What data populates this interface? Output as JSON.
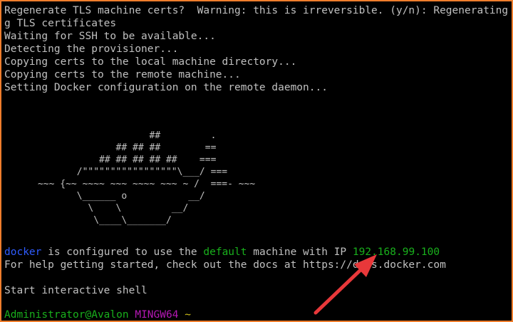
{
  "terminal": {
    "output_lines": [
      "Regenerate TLS machine certs?  Warning: this is irreversible. (y/n): Regenerating",
      "g TLS certificates",
      "Waiting for SSH to be available...",
      "Detecting the provisioner...",
      "Copying certs to the local machine directory...",
      "Copying certs to the remote machine...",
      "Setting Docker configuration on the remote daemon..."
    ],
    "whale_art": "                          ##         .\n                    ## ## ##        ==\n                 ## ## ## ## ##    ===\n             /\"\"\"\"\"\"\"\"\"\"\"\"\"\"\"\"\"\\___/ ===\n      ~~~ {~~ ~~~~ ~~~ ~~~~ ~~~ ~ /  ===- ~~~\n             \\______ o           __/\n               \\    \\         __/\n                \\____\\_______/",
    "configured": {
      "machine_tool": "docker",
      "text_1": " is configured to use the ",
      "machine_name": "default",
      "text_2": " machine with IP ",
      "ip": "192.168.99.100"
    },
    "help_line": "For help getting started, check out the docs at https://docs.docker.com",
    "shell_line": "Start interactive shell",
    "prompt": {
      "user_host": "Administrator@Avalon",
      "env": "MINGW64",
      "path": "~"
    }
  },
  "colors": {
    "border": "#ef7d2c",
    "background": "#000000",
    "text": "#c0c0c0",
    "docker": "#2f5cff",
    "default_machine": "#19b01c",
    "ip": "#19b01c",
    "prompt_user": "#19b01c",
    "prompt_env": "#b418b4",
    "prompt_path": "#d1c21a",
    "arrow": "#e8383a"
  },
  "icons": {
    "annotation": "red-arrow-icon"
  }
}
